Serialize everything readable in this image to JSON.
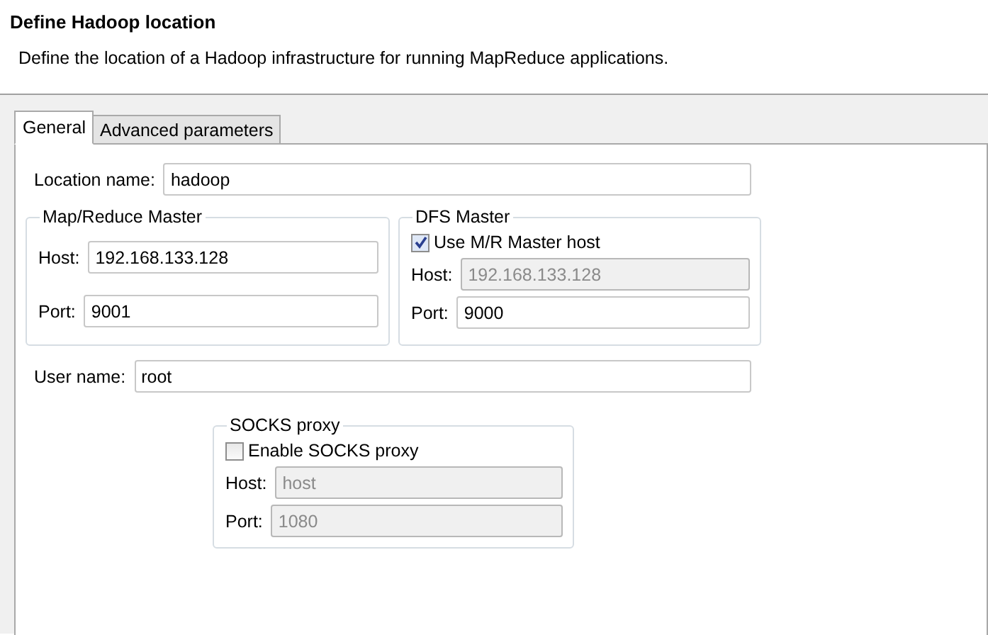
{
  "header": {
    "title": "Define Hadoop location",
    "description": "Define the location of a Hadoop infrastructure for running MapReduce applications."
  },
  "tabs": [
    {
      "label": "General",
      "selected": true
    },
    {
      "label": "Advanced parameters",
      "selected": false
    }
  ],
  "location_name": {
    "label": "Location name:",
    "value": "hadoop",
    "disabled": false
  },
  "map_reduce_master": {
    "title": "Map/Reduce Master",
    "fields": [
      {
        "label": "Host:",
        "value": "192.168.133.128",
        "disabled": false
      },
      {
        "label": "Port:",
        "value": "9001",
        "disabled": false
      }
    ]
  },
  "dfs_master": {
    "title": "DFS Master",
    "checkbox": {
      "label": "Use M/R Master host",
      "checked": true
    },
    "fields": [
      {
        "label": "Host:",
        "value": "192.168.133.128",
        "disabled": true
      },
      {
        "label": "Port:",
        "value": "9000",
        "disabled": false
      }
    ]
  },
  "user_name": {
    "label": "User name:",
    "value": "root",
    "disabled": false
  },
  "socks_proxy": {
    "title": "SOCKS proxy",
    "checkbox": {
      "label": "Enable SOCKS proxy",
      "checked": false
    },
    "fields": [
      {
        "label": "Host:",
        "value": "host",
        "disabled": true
      },
      {
        "label": "Port:",
        "value": "1080",
        "disabled": true
      }
    ]
  }
}
